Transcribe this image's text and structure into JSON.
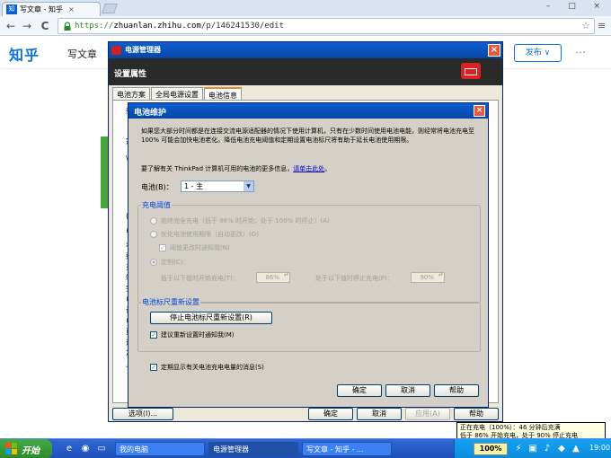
{
  "browser": {
    "tab_title": "写文章 - 知乎",
    "tab_logo": "知",
    "tab_close": "×",
    "url_scheme": "https://",
    "url_host": "zhuanlan.zhihu.com",
    "url_path": "/p/146241530/edit",
    "back_icon": "←",
    "forward_icon": "→",
    "reload_icon": "C",
    "star_icon": "☆",
    "menu_icon": "≡",
    "window_controls": [
      "–",
      "□",
      "×"
    ]
  },
  "zhihu": {
    "brand": "知乎",
    "write_label": "写文章",
    "publish_label": "发布 ∨",
    "more_icon": "⋯"
  },
  "power_manager": {
    "title": "电源管理器",
    "header_label": "设置属性",
    "tabs": [
      "电池方案",
      "全局电源设置",
      "电池信息"
    ],
    "active_tab": 2,
    "side_fragments": [
      "新",
      "宗",
      "\\",
      "(i",
      "电",
      "状",
      "剩",
      "充",
      "制",
      "完",
      "电",
      "设",
      "电",
      "页",
      "退",
      "次",
      "上"
    ],
    "buttons": {
      "options": "选项(I)...",
      "ok": "确定",
      "cancel": "取消",
      "apply": "应用(A)",
      "help": "帮助"
    }
  },
  "battery_maintenance": {
    "title": "电池维护",
    "close": "×",
    "description": "如果您大部分时间都是在连接交流电源适配器的情况下使用计算机，只有在少数时间使用电池电能，则经常将电池充电至 100% 可能会加快电池老化。降低电池充电阈值和定期设置电池标尺将有助于延长电池使用期限。",
    "more_info_prefix": "要了解有关 ThinkPad 计算机可用的电池的更多信息，",
    "more_info_link": "请单击此处",
    "more_info_suffix": "。",
    "battery_label": "电池(B)：",
    "battery_value": "1 - 主",
    "charge_threshold": {
      "title": "充电阈值",
      "option_always_full": "始终完全充电（低于 96% 时开始；处于 100% 时停止）(A)",
      "option_optimize": "优化电池使用期限（自动更改）(O)",
      "notify_threshold_change": "阈值更改时通知我(N)",
      "option_custom": "定制(C)：",
      "start_label": "低于以下值时开始充电(T)：",
      "start_value": "86%",
      "stop_label": "处于以下值时停止充电(P)：",
      "stop_value": "90%"
    },
    "calibration": {
      "title": "电池标尺重新设置",
      "stop_button": "停止电池标尺重新设置(R)",
      "suggest_notify": "建议重新设置时通知我(M)"
    },
    "periodic_message": "定期显示有关电池充电电量的消息(S)",
    "buttons": {
      "ok": "确定",
      "cancel": "取消",
      "help": "帮助"
    }
  },
  "tooltip": {
    "line1": "正在充电（100%）：46 分钟后充满",
    "line2": "低于 86% 开始充电，处于 90% 停止充电"
  },
  "taskbar": {
    "start_label": "开始",
    "tasks": [
      "我的电脑",
      "电源管理器",
      "写文章 - 知乎 - ..."
    ],
    "active_task": 1,
    "battery_percent": "100%",
    "clock": "19:00"
  },
  "colors": {
    "xp_title": "#0a5fd1",
    "zhihu_blue": "#0a74d9",
    "battery_red": "#e02020"
  }
}
